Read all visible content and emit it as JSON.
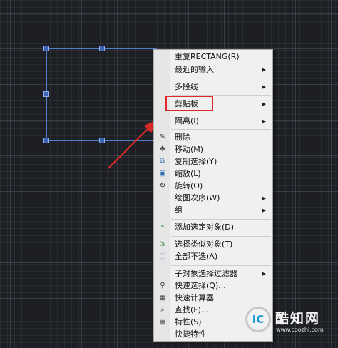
{
  "menu": {
    "items": [
      {
        "label": "重复RECTANG(R)",
        "arrow": false,
        "icon": ""
      },
      {
        "label": "最近的输入",
        "arrow": true,
        "icon": ""
      },
      {
        "label": "多段线",
        "arrow": true,
        "icon": ""
      },
      {
        "label": "剪贴板",
        "arrow": true,
        "icon": ""
      },
      {
        "label": "隔离(I)",
        "arrow": true,
        "icon": ""
      },
      {
        "label": "删除",
        "arrow": false,
        "icon": "eraser-icon"
      },
      {
        "label": "移动(M)",
        "arrow": false,
        "icon": "move-icon"
      },
      {
        "label": "复制选择(Y)",
        "arrow": false,
        "icon": "copy-icon"
      },
      {
        "label": "缩放(L)",
        "arrow": false,
        "icon": "scale-icon"
      },
      {
        "label": "旋转(O)",
        "arrow": false,
        "icon": "rotate-icon"
      },
      {
        "label": "绘图次序(W)",
        "arrow": true,
        "icon": ""
      },
      {
        "label": "组",
        "arrow": true,
        "icon": ""
      },
      {
        "label": "添加选定对象(D)",
        "arrow": false,
        "icon": "add-selected-icon"
      },
      {
        "label": "选择类似对象(T)",
        "arrow": false,
        "icon": "select-similar-icon"
      },
      {
        "label": "全部不选(A)",
        "arrow": false,
        "icon": "deselect-icon"
      },
      {
        "label": "子对象选择过滤器",
        "arrow": true,
        "icon": ""
      },
      {
        "label": "快速选择(Q)...",
        "arrow": false,
        "icon": "quick-select-icon"
      },
      {
        "label": "快速计算器",
        "arrow": false,
        "icon": "calculator-icon"
      },
      {
        "label": "查找(F)...",
        "arrow": false,
        "icon": "find-icon"
      },
      {
        "label": "特性(S)",
        "arrow": false,
        "icon": "properties-icon"
      },
      {
        "label": "快捷特性",
        "arrow": false,
        "icon": ""
      }
    ]
  },
  "watermark": {
    "logo_letter": "IC",
    "name": "酷知网",
    "url": "www.coozhi.com"
  },
  "colors": {
    "highlight": "#e0282c",
    "rectangle": "#4f7fc7",
    "background": "#1d1f24"
  }
}
